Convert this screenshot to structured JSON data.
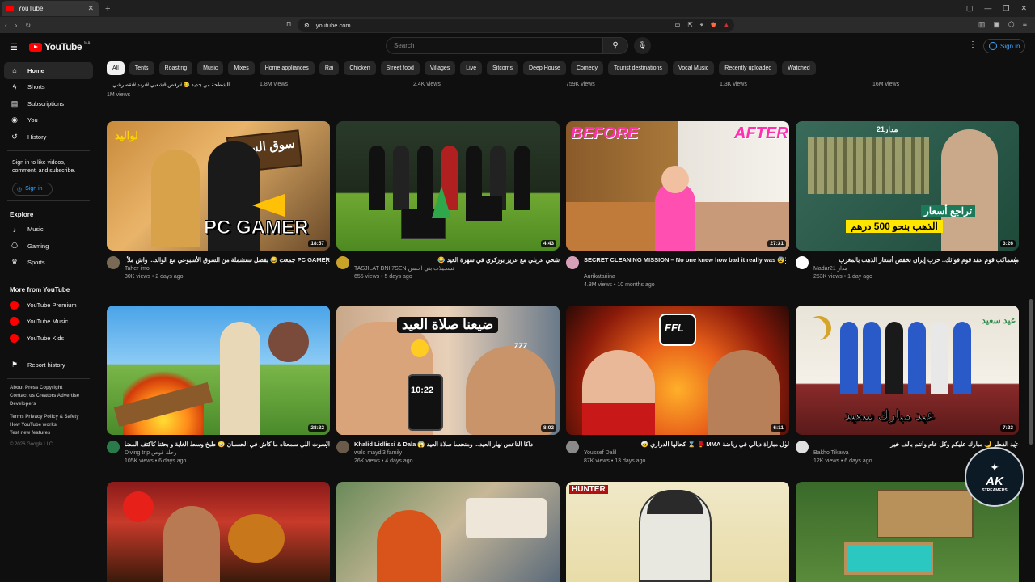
{
  "browser": {
    "tab_title": "YouTube",
    "url": "youtube.com"
  },
  "header": {
    "logo": "YouTube",
    "country_code": "MA",
    "search_placeholder": "Search",
    "sign_in": "Sign in"
  },
  "sidebar": {
    "main": [
      {
        "label": "Home",
        "icon": "home-icon",
        "active": true
      },
      {
        "label": "Shorts",
        "icon": "shorts-icon"
      },
      {
        "label": "Subscriptions",
        "icon": "subscriptions-icon"
      },
      {
        "label": "You",
        "icon": "user-icon"
      },
      {
        "label": "History",
        "icon": "history-icon"
      }
    ],
    "signin_prompt": "Sign in to like videos, comment, and subscribe.",
    "signin_button": "Sign in",
    "explore_title": "Explore",
    "explore": [
      {
        "label": "Music",
        "icon": "music-icon"
      },
      {
        "label": "Gaming",
        "icon": "gaming-icon"
      },
      {
        "label": "Sports",
        "icon": "trophy-icon"
      }
    ],
    "more_title": "More from YouTube",
    "more": [
      {
        "label": "YouTube Premium"
      },
      {
        "label": "YouTube Music"
      },
      {
        "label": "YouTube Kids"
      }
    ],
    "report": "Report history",
    "footer1": "About  Press  Copyright",
    "footer2": "Contact us  Creators  Advertise",
    "footer3": "Developers",
    "footer4": "Terms  Privacy  Policy & Safety",
    "footer5": "How YouTube works",
    "footer6": "Test new features",
    "copyright": "© 2026 Google LLC"
  },
  "chips": [
    "All",
    "Tents",
    "Roasting",
    "Music",
    "Mixes",
    "Home appliances",
    "Rai",
    "Chicken",
    "Street food",
    "Villages",
    "Live",
    "Sitcoms",
    "Deep House",
    "Comedy",
    "Tourist destinations",
    "Vocal Music",
    "Recently uploaded",
    "Watched"
  ],
  "prev_row": {
    "title_fragment": "... الشطحة من جديد 😂 #رقص #شعبي #ترند #تقصرشي",
    "views": [
      "1M views",
      "1.8M views",
      "2.4K views",
      "759K views",
      "1.3K views",
      "16M views"
    ]
  },
  "videos": [
    {
      "title": "PC GAMER جمعت 😂 بفضل ستشملة من السوق الأسبوعي مع الوالد... واش ملأ غيجم؟",
      "channel": "Taher imo",
      "stats": "30K views • 2 days ago",
      "duration": "18:57",
      "overlay": "PC GAMER",
      "overlay2": "سوق الست",
      "overlay3": "لواليد"
    },
    {
      "title": "شحي عزبلي مع عزيز بوزكري في سهرة العيد 😂",
      "channel": "TASJILAT BNI 7SEN تسجيلات بني احسن",
      "stats": "655 views • 5 days ago",
      "duration": "4:43"
    },
    {
      "title": "SECRET CLEANING MISSION – No one knew how bad it really was 😨",
      "channel": "Aurikatariina",
      "stats": "4.8M views • 10 months ago",
      "duration": "27:31",
      "overlay": "BEFORE",
      "overlay2": "AFTER"
    },
    {
      "title": "مسماكب قوم عقد قوم فوائك.. حرب إيران تخفض أسعار الذهب بالمغرب",
      "channel": "Madar21 مدار",
      "stats": "253K views • 1 day ago",
      "duration": "3:26",
      "overlay": "تراجع أسعار",
      "overlay2": "الذهب بنحو 500 درهم",
      "overlay3": "مدار21"
    },
    {
      "title": "السوت اللي سمعناه ما كاش في الحسبان 😳 طبخ وسط الغابة و بحثنا كاكتف المضاي... 🔥",
      "channel": "Diving trip رحلة غوص",
      "stats": "105K views • 6 days ago",
      "duration": "28:32"
    },
    {
      "title": "Khalid Lidlissi & Dala 😱 داكا الناعس نهار العيد... ومنحسا صلاة العيد",
      "channel": "walo maydi3 family",
      "stats": "26K views • 4 days ago",
      "duration": "8:02",
      "overlay": "ضيعنا صلاة العيد",
      "overlay2": "10:22",
      "overlay3": "ZZZ"
    },
    {
      "title": "لول مباراة ديالي في رياضة MMA 🥊 ⌛ كحالها الدراري 🤕",
      "channel": "Youssef Dalil",
      "stats": "87K views • 13 days ago",
      "duration": "6:11",
      "overlay": "FFL"
    },
    {
      "title": "عيد الفطر 🌙 مبارك عليكم وكل عام وأنتم بألف خير",
      "channel": "Bakho Tikawa",
      "stats": "12K views • 6 days ago",
      "duration": "7:23",
      "overlay": "عيد مبارك سعيد",
      "overlay2": "عيد سعيد"
    },
    {
      "title": "",
      "channel": "",
      "stats": "",
      "duration": ""
    },
    {
      "title": "",
      "channel": "",
      "stats": "",
      "duration": ""
    },
    {
      "title": "",
      "channel": "",
      "stats": "",
      "duration": "",
      "overlay": "HUNTER"
    },
    {
      "title": "",
      "channel": "",
      "stats": "",
      "duration": ""
    }
  ],
  "watermark": {
    "main": "AK",
    "sub": "STREAMERS"
  }
}
